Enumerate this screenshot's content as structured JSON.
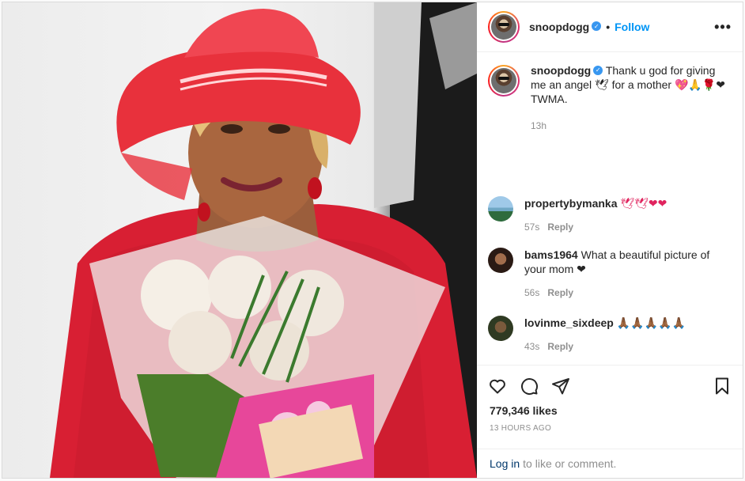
{
  "post": {
    "username": "snoopdogg",
    "follow_label": "Follow",
    "more_glyph": "•••",
    "separator": "•",
    "caption": {
      "text": "Thank u god for giving me an angel 🕊 for a mother 💖🙏🌹❤ TWMA.",
      "age": "13h"
    },
    "comments": [
      {
        "username": "propertybymanka",
        "text": "🕊🕊❤❤",
        "age": "57s",
        "reply": "Reply"
      },
      {
        "username": "bams1964",
        "text": "What a beautiful picture of your mom ❤",
        "age": "56s",
        "reply": "Reply"
      },
      {
        "username": "lovinme_sixdeep",
        "text": "🙏🏾🙏🏾🙏🏾🙏🏾🙏🏾",
        "age": "43s",
        "reply": "Reply"
      }
    ],
    "likes": "779,346 likes",
    "timestamp": "13 HOURS AGO",
    "login_link": "Log in",
    "login_text": "to like or comment."
  },
  "icons": {
    "heart": "heart-icon",
    "comment": "comment-icon",
    "share": "share-icon",
    "save": "bookmark-icon",
    "verified": "verified-badge-icon"
  },
  "colors": {
    "accent": "#0095f6",
    "verified": "#3897f0",
    "muted": "#8e8e8e",
    "link": "#00376b"
  }
}
